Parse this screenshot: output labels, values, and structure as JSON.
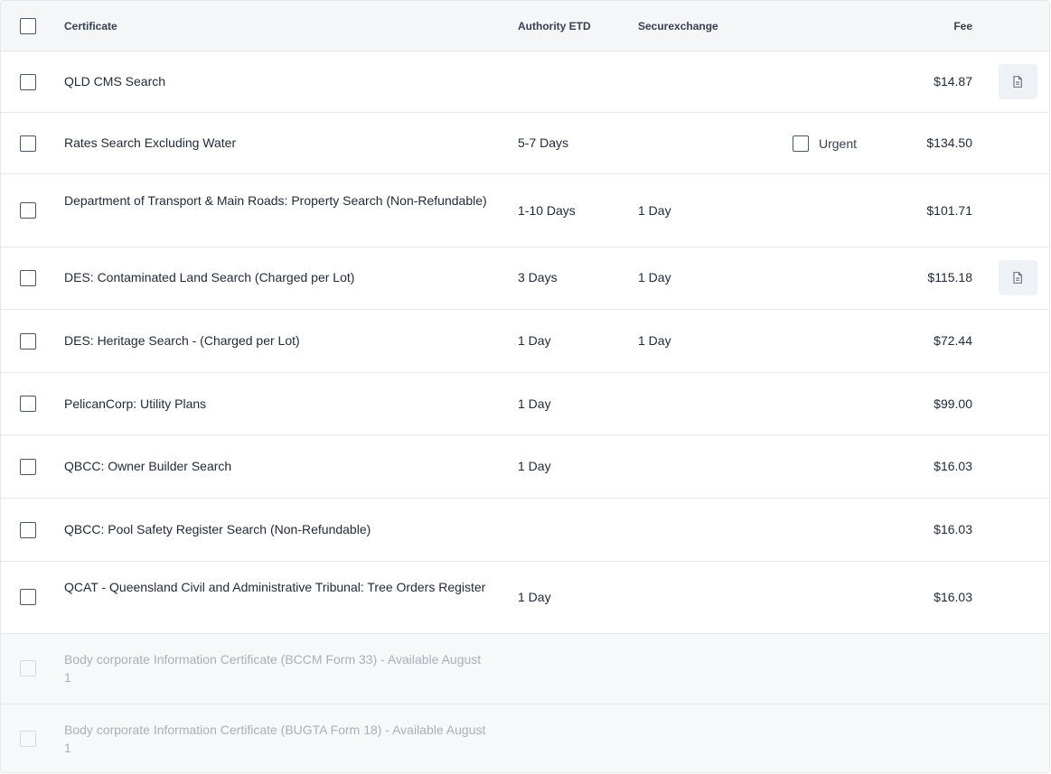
{
  "header": {
    "certificate": "Certificate",
    "authority_etd": "Authority ETD",
    "securexchange": "Securexchange",
    "fee": "Fee"
  },
  "rows": [
    {
      "name": "QLD CMS Search",
      "authority_etd": "",
      "securexchange": "",
      "fee": "$14.87",
      "doc_icon": "document-icon"
    },
    {
      "name": "Rates Search Excluding Water",
      "authority_etd": "5-7 Days",
      "securexchange": "",
      "urgent_label": "Urgent",
      "fee": "$134.50"
    },
    {
      "name": "Department of Transport & Main Roads: Property Search (Non-Refundable)",
      "authority_etd": "1-10 Days",
      "securexchange": "1 Day",
      "fee": "$101.71"
    },
    {
      "name": "DES: Contaminated Land Search (Charged per Lot)",
      "authority_etd": "3 Days",
      "securexchange": "1 Day",
      "fee": "$115.18",
      "doc_icon": "document-icon"
    },
    {
      "name": "DES: Heritage Search - (Charged per Lot)",
      "authority_etd": "1 Day",
      "securexchange": "1 Day",
      "fee": "$72.44"
    },
    {
      "name": "PelicanCorp: Utility Plans",
      "authority_etd": "1 Day",
      "securexchange": "",
      "fee": "$99.00"
    },
    {
      "name": "QBCC: Owner Builder Search",
      "authority_etd": "1 Day",
      "securexchange": "",
      "fee": "$16.03"
    },
    {
      "name": "QBCC: Pool Safety Register Search (Non-Refundable)",
      "authority_etd": "",
      "securexchange": "",
      "fee": "$16.03"
    },
    {
      "name": "QCAT - Queensland Civil and Administrative Tribunal: Tree Orders Register",
      "authority_etd": "1 Day",
      "securexchange": "",
      "fee": "$16.03"
    },
    {
      "name": "Body corporate Information Certificate (BCCM Form 33) - Available August 1",
      "disabled": true
    },
    {
      "name": "Body corporate Information Certificate (BUGTA Form 18) - Available August 1",
      "disabled": true
    }
  ],
  "colors": {
    "border": "#e5e7eb",
    "header_bg": "#f5f6f8",
    "disabled_text": "#a8b0bb",
    "icon_button_bg": "#eef1f5"
  }
}
